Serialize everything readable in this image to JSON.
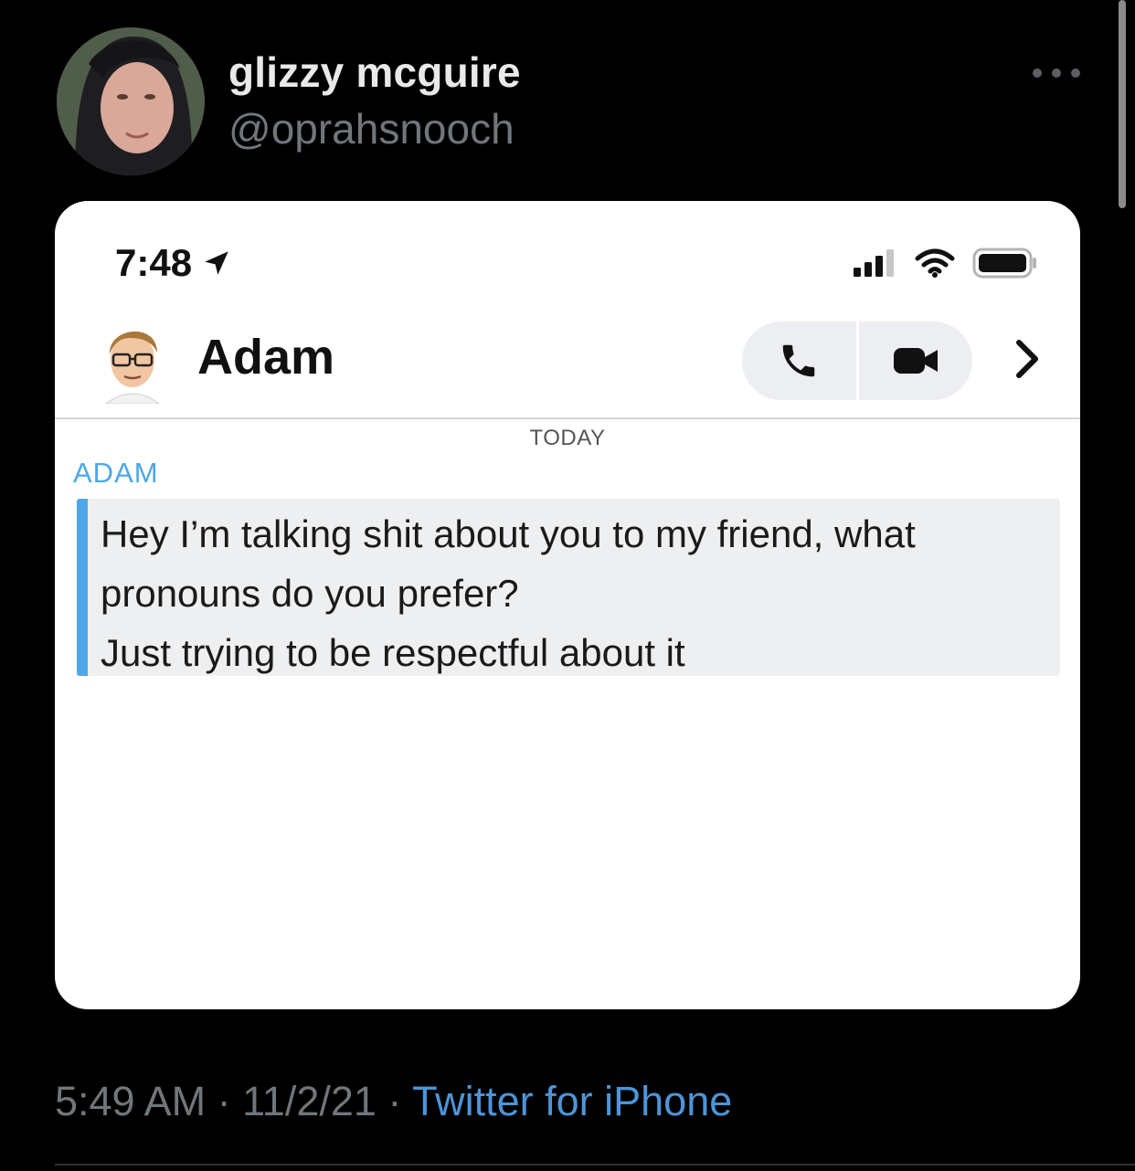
{
  "tweet": {
    "display_name": "glizzy mcguire",
    "handle": "@oprahsnooch",
    "time": "5:49 AM",
    "date": "11/2/21",
    "sep1": " · ",
    "sep2": " · ",
    "source": "Twitter for iPhone"
  },
  "phone": {
    "status_time": "7:48",
    "contact_name": "Adam",
    "day_label": "TODAY",
    "sender_label": "ADAM",
    "message_lines": [
      "Hey I’m talking shit about you to my friend, what",
      "pronouns do you prefer?",
      "Just trying to be respectful about it"
    ]
  },
  "colors": {
    "background": "#000000",
    "name": "#e7e9ea",
    "secondary_text": "#71767b",
    "link": "#4d94d8",
    "snap_blue": "#4da7e8"
  },
  "icons": [
    "more-icon",
    "location-arrow-icon",
    "signal-icon",
    "wifi-icon",
    "battery-icon",
    "phone-icon",
    "video-camera-icon",
    "chevron-right-icon"
  ]
}
